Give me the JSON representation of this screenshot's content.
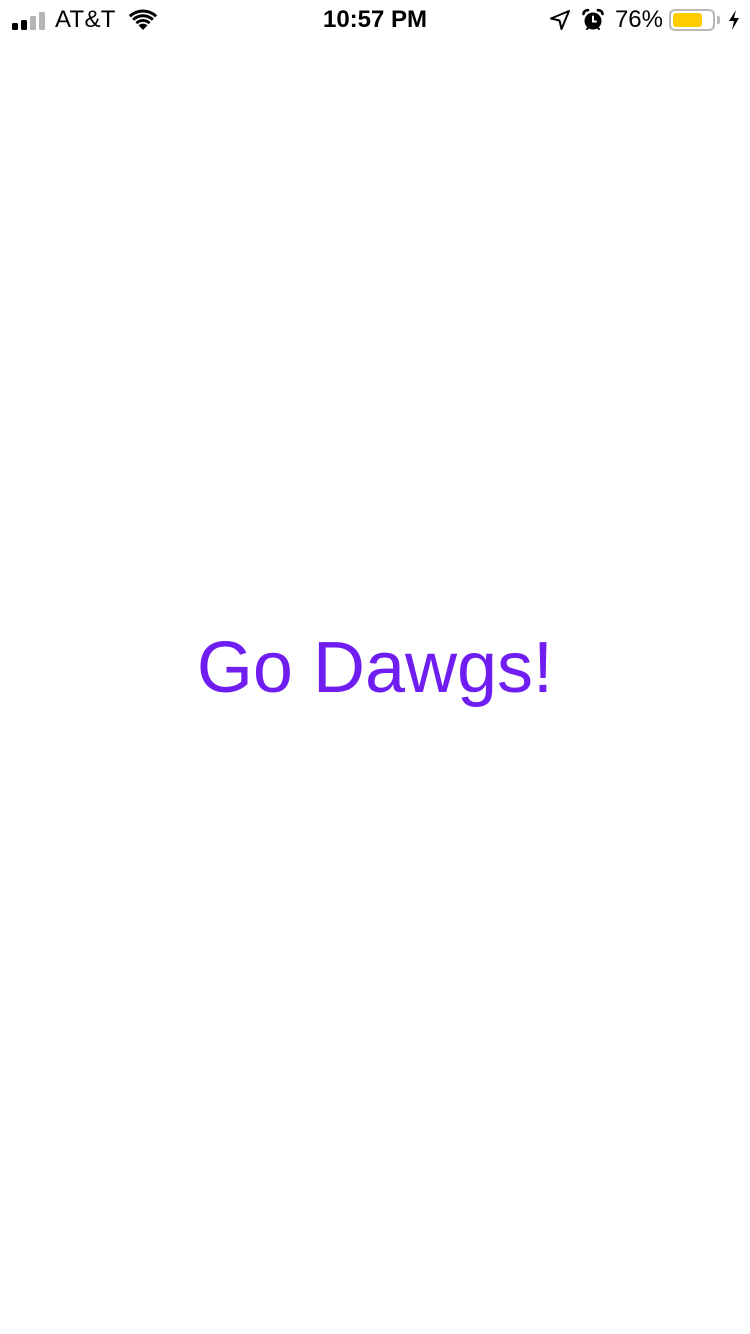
{
  "status_bar": {
    "carrier": "AT&T",
    "time": "10:57 PM",
    "battery_percent": "76%",
    "battery_level": 0.76,
    "signal_bars_filled": 2,
    "signal_bars_total": 4,
    "icons": [
      "signal-bars-icon",
      "wifi-icon",
      "location-arrow-icon",
      "alarm-clock-icon",
      "battery-icon",
      "charging-bolt-icon"
    ]
  },
  "main": {
    "message": "Go Dawgs!"
  },
  "colors": {
    "message": "#6f1df1",
    "battery_fill": "#ffcc00",
    "signal_active": "#000000",
    "signal_inactive": "#b5b5b5"
  }
}
